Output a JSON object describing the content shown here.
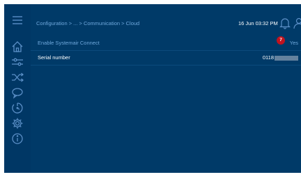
{
  "header": {
    "breadcrumb": "Configuration > ... > Communication > Cloud",
    "datetime": "16 Jun 03:32 PM"
  },
  "sidebar": {
    "items": [
      {
        "icon": "menu-icon"
      },
      {
        "icon": "home-icon"
      },
      {
        "icon": "sliders-icon"
      },
      {
        "icon": "shuffle-icon"
      },
      {
        "icon": "chat-icon"
      },
      {
        "icon": "history-icon"
      },
      {
        "icon": "gear-icon"
      },
      {
        "icon": "info-icon"
      }
    ]
  },
  "rows": [
    {
      "label": "Enable Systemair Connect",
      "value": "Yes"
    },
    {
      "label": "Serial number",
      "value": "0118"
    }
  ],
  "alarm_badge": "7",
  "colors": {
    "background": "#003a68",
    "accent": "#6fa8dc",
    "text": "#ffffff",
    "badge": "#c0131f"
  }
}
